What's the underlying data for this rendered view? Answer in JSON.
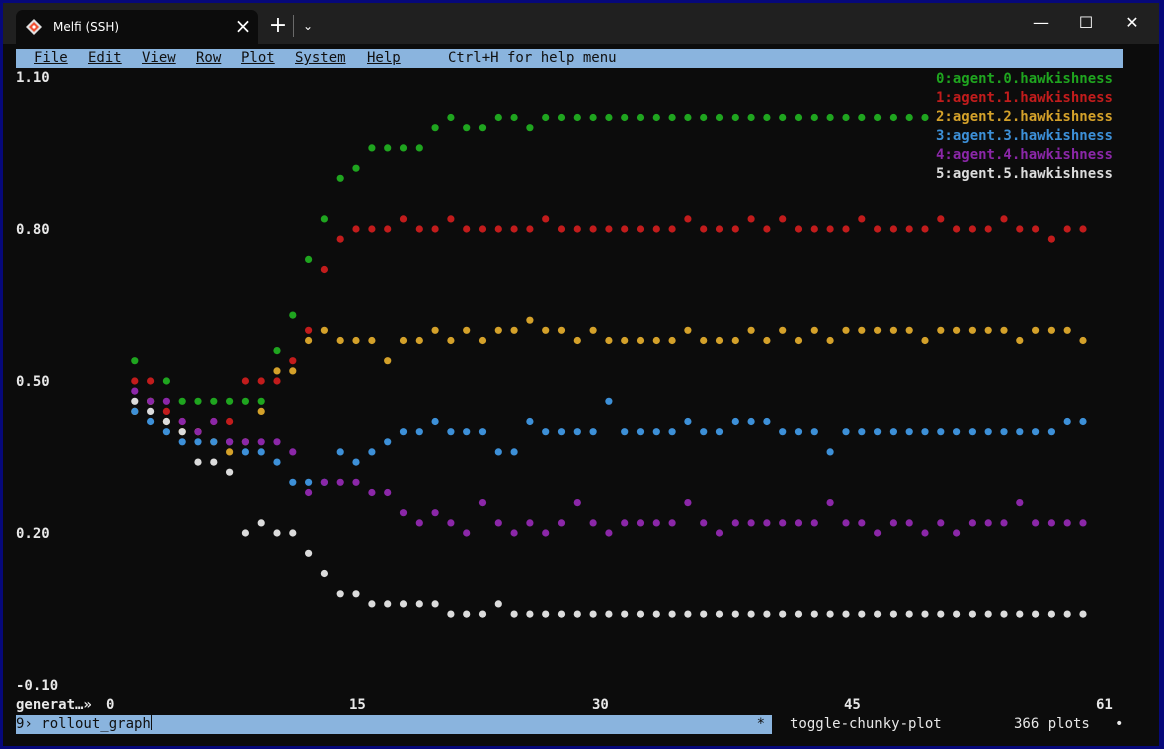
{
  "window": {
    "tab_title": "Melfi (SSH)",
    "new_tab": "+",
    "dropdown": "⌄",
    "close_tab": "×",
    "minimize": "—",
    "maximize": "☐",
    "close": "✕"
  },
  "menu": {
    "items": [
      {
        "label": "File"
      },
      {
        "label": "Edit"
      },
      {
        "label": "View"
      },
      {
        "label": "Row"
      },
      {
        "label": "Plot"
      },
      {
        "label": "System"
      },
      {
        "label": "Help"
      }
    ],
    "hint": "Ctrl+H for help menu"
  },
  "command_line": {
    "text": "9› rollout_graph",
    "marker": "*"
  },
  "status": {
    "command": "toggle-chunky-plot",
    "count": "366 plots",
    "indicator": "•"
  },
  "chart_data": {
    "type": "scatter",
    "xlabel": "generat…»",
    "xlim": [
      0,
      61
    ],
    "ylim": [
      -0.1,
      1.1
    ],
    "x_ticks": [
      0,
      15,
      30,
      45,
      61
    ],
    "y_ticks": [
      "1.10",
      "0.80",
      "0.50",
      "0.20",
      "-0.10"
    ],
    "grid": false,
    "legend_position": "top-right",
    "series": [
      {
        "name": "0:agent.0.hawkishness",
        "color": "#1fa51f",
        "x": [
          1,
          2,
          3,
          4,
          5,
          6,
          7,
          8,
          9,
          10,
          11,
          12,
          13,
          14,
          15,
          16,
          17,
          18,
          19,
          20,
          21,
          22,
          23,
          24,
          25,
          26,
          27,
          28,
          29,
          30,
          31,
          32,
          33,
          34,
          35,
          36,
          37,
          38,
          39,
          40,
          41,
          42,
          43,
          44,
          45,
          46,
          47,
          48,
          49,
          50,
          51
        ],
        "y": [
          0.54,
          0.46,
          0.5,
          0.46,
          0.46,
          0.46,
          0.46,
          0.46,
          0.46,
          0.56,
          0.63,
          0.74,
          0.82,
          0.9,
          0.92,
          0.96,
          0.96,
          0.96,
          0.96,
          1.0,
          1.02,
          1.0,
          1.0,
          1.02,
          1.02,
          1.0,
          1.02,
          1.02,
          1.02,
          1.02,
          1.02,
          1.02,
          1.02,
          1.02,
          1.02,
          1.02,
          1.02,
          1.02,
          1.02,
          1.02,
          1.02,
          1.02,
          1.02,
          1.02,
          1.02,
          1.02,
          1.02,
          1.02,
          1.02,
          1.02,
          1.02
        ]
      },
      {
        "name": "1:agent.1.hawkishness",
        "color": "#c21c1c",
        "x": [
          1,
          2,
          3,
          4,
          5,
          6,
          7,
          8,
          9,
          10,
          11,
          12,
          13,
          14,
          15,
          16,
          17,
          18,
          19,
          20,
          21,
          22,
          23,
          24,
          25,
          26,
          27,
          28,
          29,
          30,
          31,
          32,
          33,
          34,
          35,
          36,
          37,
          38,
          39,
          40,
          41,
          42,
          43,
          44,
          45,
          46,
          47,
          48,
          49,
          50,
          51,
          52,
          53,
          54,
          55,
          56,
          57,
          58,
          59,
          60,
          61
        ],
        "y": [
          0.5,
          0.5,
          0.44,
          0.42,
          0.4,
          0.42,
          0.42,
          0.5,
          0.5,
          0.5,
          0.54,
          0.6,
          0.72,
          0.78,
          0.8,
          0.8,
          0.8,
          0.82,
          0.8,
          0.8,
          0.82,
          0.8,
          0.8,
          0.8,
          0.8,
          0.8,
          0.82,
          0.8,
          0.8,
          0.8,
          0.8,
          0.8,
          0.8,
          0.8,
          0.8,
          0.82,
          0.8,
          0.8,
          0.8,
          0.82,
          0.8,
          0.82,
          0.8,
          0.8,
          0.8,
          0.8,
          0.82,
          0.8,
          0.8,
          0.8,
          0.8,
          0.82,
          0.8,
          0.8,
          0.8,
          0.82,
          0.8,
          0.8,
          0.78,
          0.8,
          0.8
        ]
      },
      {
        "name": "2:agent.2.hawkishness",
        "color": "#d4a12a",
        "x": [
          1,
          2,
          3,
          4,
          5,
          6,
          7,
          8,
          9,
          10,
          11,
          12,
          13,
          14,
          15,
          16,
          17,
          18,
          19,
          20,
          21,
          22,
          23,
          24,
          25,
          26,
          27,
          28,
          29,
          30,
          31,
          32,
          33,
          34,
          35,
          36,
          37,
          38,
          39,
          40,
          41,
          42,
          43,
          44,
          45,
          46,
          47,
          48,
          49,
          50,
          51,
          52,
          53,
          54,
          55,
          56,
          57,
          58,
          59,
          60,
          61
        ],
        "y": [
          0.44,
          0.46,
          0.42,
          0.4,
          0.4,
          0.38,
          0.36,
          0.38,
          0.44,
          0.52,
          0.52,
          0.58,
          0.6,
          0.58,
          0.58,
          0.58,
          0.54,
          0.58,
          0.58,
          0.6,
          0.58,
          0.6,
          0.58,
          0.6,
          0.6,
          0.62,
          0.6,
          0.6,
          0.58,
          0.6,
          0.58,
          0.58,
          0.58,
          0.58,
          0.58,
          0.6,
          0.58,
          0.58,
          0.58,
          0.6,
          0.58,
          0.6,
          0.58,
          0.6,
          0.58,
          0.6,
          0.6,
          0.6,
          0.6,
          0.6,
          0.58,
          0.6,
          0.6,
          0.6,
          0.6,
          0.6,
          0.58,
          0.6,
          0.6,
          0.6,
          0.58
        ]
      },
      {
        "name": "3:agent.3.hawkishness",
        "color": "#3d90d8",
        "x": [
          1,
          2,
          3,
          4,
          5,
          6,
          7,
          8,
          9,
          10,
          11,
          12,
          13,
          14,
          15,
          16,
          17,
          18,
          19,
          20,
          21,
          22,
          23,
          24,
          25,
          26,
          27,
          28,
          29,
          30,
          31,
          32,
          33,
          34,
          35,
          36,
          37,
          38,
          39,
          40,
          41,
          42,
          43,
          44,
          45,
          46,
          47,
          48,
          49,
          50,
          51,
          52,
          53,
          54,
          55,
          56,
          57,
          58,
          59,
          60,
          61
        ],
        "y": [
          0.44,
          0.42,
          0.4,
          0.38,
          0.38,
          0.38,
          0.38,
          0.36,
          0.36,
          0.34,
          0.3,
          0.3,
          0.3,
          0.36,
          0.34,
          0.36,
          0.38,
          0.4,
          0.4,
          0.42,
          0.4,
          0.4,
          0.4,
          0.36,
          0.36,
          0.42,
          0.4,
          0.4,
          0.4,
          0.4,
          0.46,
          0.4,
          0.4,
          0.4,
          0.4,
          0.42,
          0.4,
          0.4,
          0.42,
          0.42,
          0.42,
          0.4,
          0.4,
          0.4,
          0.36,
          0.4,
          0.4,
          0.4,
          0.4,
          0.4,
          0.4,
          0.4,
          0.4,
          0.4,
          0.4,
          0.4,
          0.4,
          0.4,
          0.4,
          0.42,
          0.42
        ]
      },
      {
        "name": "4:agent.4.hawkishness",
        "color": "#8b27a8",
        "x": [
          1,
          2,
          3,
          4,
          5,
          6,
          7,
          8,
          9,
          10,
          11,
          12,
          13,
          14,
          15,
          16,
          17,
          18,
          19,
          20,
          21,
          22,
          23,
          24,
          25,
          26,
          27,
          28,
          29,
          30,
          31,
          32,
          33,
          34,
          35,
          36,
          37,
          38,
          39,
          40,
          41,
          42,
          43,
          44,
          45,
          46,
          47,
          48,
          49,
          50,
          51,
          52,
          53,
          54,
          55,
          56,
          57,
          58,
          59,
          60,
          61
        ],
        "y": [
          0.48,
          0.46,
          0.46,
          0.42,
          0.4,
          0.42,
          0.38,
          0.38,
          0.38,
          0.38,
          0.36,
          0.28,
          0.3,
          0.3,
          0.3,
          0.28,
          0.28,
          0.24,
          0.22,
          0.24,
          0.22,
          0.2,
          0.26,
          0.22,
          0.2,
          0.22,
          0.2,
          0.22,
          0.26,
          0.22,
          0.2,
          0.22,
          0.22,
          0.22,
          0.22,
          0.26,
          0.22,
          0.2,
          0.22,
          0.22,
          0.22,
          0.22,
          0.22,
          0.22,
          0.26,
          0.22,
          0.22,
          0.2,
          0.22,
          0.22,
          0.2,
          0.22,
          0.2,
          0.22,
          0.22,
          0.22,
          0.26,
          0.22,
          0.22,
          0.22,
          0.22
        ]
      },
      {
        "name": "5:agent.5.hawkishness",
        "color": "#dcdcdc",
        "x": [
          1,
          2,
          3,
          4,
          5,
          6,
          7,
          8,
          9,
          10,
          11,
          12,
          13,
          14,
          15,
          16,
          17,
          18,
          19,
          20,
          21,
          22,
          23,
          24,
          25,
          26,
          27,
          28,
          29,
          30,
          31,
          32,
          33,
          34,
          35,
          36,
          37,
          38,
          39,
          40,
          41,
          42,
          43,
          44,
          45,
          46,
          47,
          48,
          49,
          50,
          51,
          52,
          53,
          54,
          55,
          56,
          57,
          58,
          59,
          60,
          61
        ],
        "y": [
          0.46,
          0.44,
          0.42,
          0.4,
          0.34,
          0.34,
          0.32,
          0.2,
          0.22,
          0.2,
          0.2,
          0.16,
          0.12,
          0.08,
          0.08,
          0.06,
          0.06,
          0.06,
          0.06,
          0.06,
          0.04,
          0.04,
          0.04,
          0.06,
          0.04,
          0.04,
          0.04,
          0.04,
          0.04,
          0.04,
          0.04,
          0.04,
          0.04,
          0.04,
          0.04,
          0.04,
          0.04,
          0.04,
          0.04,
          0.04,
          0.04,
          0.04,
          0.04,
          0.04,
          0.04,
          0.04,
          0.04,
          0.04,
          0.04,
          0.04,
          0.04,
          0.04,
          0.04,
          0.04,
          0.04,
          0.04,
          0.04,
          0.04,
          0.04,
          0.04,
          0.04
        ]
      }
    ]
  }
}
